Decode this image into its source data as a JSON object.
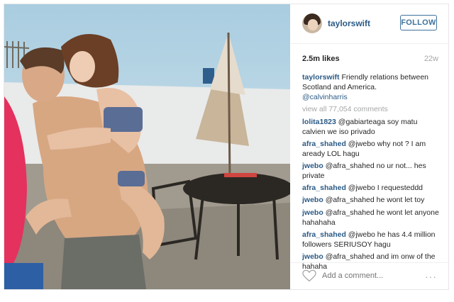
{
  "post": {
    "username": "taylorswift",
    "follow_label": "FOLLOW",
    "likes": "2.5m likes",
    "age": "22w",
    "caption": {
      "user": "taylorswift",
      "text": "Friendly relations between Scotland and America.",
      "mention": "@calvinharris"
    },
    "view_all": "view all 77,054 comments",
    "comments": [
      {
        "user": "lolita1823",
        "text": "@gabiarteaga soy matu calvien we iso privado"
      },
      {
        "user": "afra_shahed",
        "text": "@jwebo why not ? I am aready LOL hagu"
      },
      {
        "user": "jwebo",
        "text": "@afra_shahed no ur not... hes private"
      },
      {
        "user": "afra_shahed",
        "text": "@jwebo I requesteddd"
      },
      {
        "user": "jwebo",
        "text": "@afra_shahed he wont let toy"
      },
      {
        "user": "jwebo",
        "text": "@afra_shahed he wont let anyone hahahaha"
      },
      {
        "user": "afra_shahed",
        "text": "@jwebo he has 4.4 million followers SERIUSOY hagu"
      },
      {
        "user": "jwebo",
        "text": "@afra_shahed and im onw of the hahaha"
      }
    ],
    "add_comment_placeholder": "Add a comment...",
    "more_label": "···"
  },
  "icons": {
    "heart": "heart-outline-icon",
    "more": "ellipsis-icon"
  },
  "colors": {
    "link": "#2b5a85",
    "follow": "#3f729b",
    "muted": "#a5a7aa"
  }
}
